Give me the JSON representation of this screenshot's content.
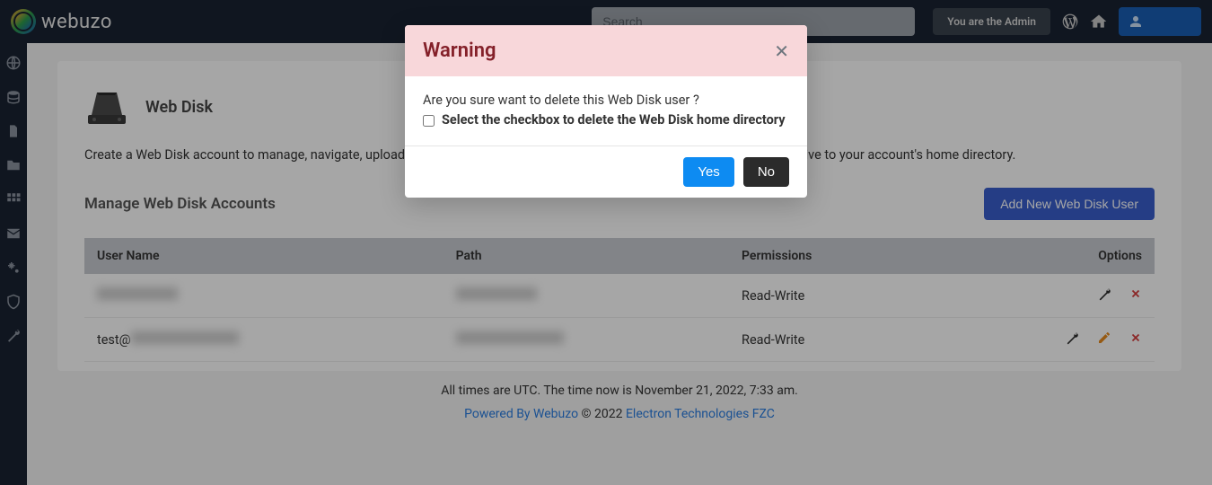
{
  "header": {
    "brand": "webuzo",
    "search_placeholder": "Search",
    "admin_label": "You are the Admin"
  },
  "page": {
    "title": "Web Disk",
    "description": "Create a Web Disk account to manage, navigate, upload, and download the files on your web server. The directories exist relative to your account's home directory.",
    "manage_title": "Manage Web Disk Accounts",
    "add_button": "Add New Web Disk User"
  },
  "table": {
    "columns": {
      "user": "User Name",
      "path": "Path",
      "permissions": "Permissions",
      "options": "Options"
    },
    "rows": [
      {
        "user_prefix": "",
        "user_blur": true,
        "path_blur": true,
        "permissions": "Read-Write",
        "has_edit": false
      },
      {
        "user_prefix": "test@",
        "user_blur": true,
        "path_blur": true,
        "permissions": "Read-Write",
        "has_edit": true
      }
    ]
  },
  "footer": {
    "time_text": "All times are UTC. The time now is November 21, 2022, 7:33 am.",
    "powered": "Powered By Webuzo",
    "copyright": " © 2022 ",
    "company": "Electron Technologies FZC"
  },
  "modal": {
    "title": "Warning",
    "question": "Are you sure want to delete this Web Disk user ?",
    "checkbox_label": "Select the checkbox to delete the Web Disk home directory",
    "yes": "Yes",
    "no": "No"
  }
}
